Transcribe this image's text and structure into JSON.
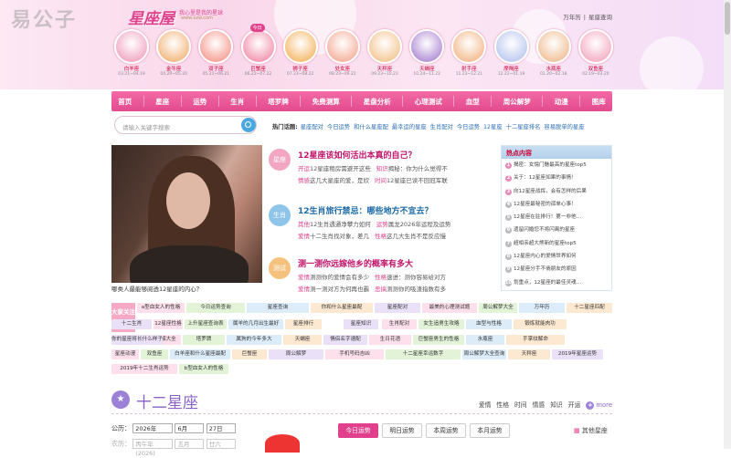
{
  "watermark": "易公子",
  "logo": {
    "title": "星座屋",
    "slogan": "我心里是我的星球",
    "url": "www.xzw.com"
  },
  "top_links": [
    "万年历",
    "|",
    "星座查询"
  ],
  "signs": [
    {
      "name": "白羊座",
      "date": "03.21~04.19",
      "color": "#f2b0c9"
    },
    {
      "name": "金牛座",
      "date": "04.20~05.20",
      "color": "#f4c08e"
    },
    {
      "name": "双子座",
      "date": "05.21~06.21",
      "color": "#f7a9a0"
    },
    {
      "name": "巨蟹座",
      "date": "06.22~07.22",
      "color": "#f3a0b8",
      "today": "今日"
    },
    {
      "name": "狮子座",
      "date": "07.23~08.22",
      "color": "#f6c17c"
    },
    {
      "name": "处女座",
      "date": "08.23~09.22",
      "color": "#f6b9a7"
    },
    {
      "name": "天秤座",
      "date": "09.23~10.23",
      "color": "#f5cda0"
    },
    {
      "name": "天蝎座",
      "date": "10.24~11.22",
      "color": "#b99ad9"
    },
    {
      "name": "射手座",
      "date": "11.23~12.21",
      "color": "#f4c39b"
    },
    {
      "name": "摩羯座",
      "date": "12.22~01.19",
      "color": "#c3cff0"
    },
    {
      "name": "水瓶座",
      "date": "01.20~02.18",
      "color": "#f2c7a3"
    },
    {
      "name": "双鱼座",
      "date": "02.19~03.20",
      "color": "#f6b7cb"
    }
  ],
  "nav": [
    "首页",
    "星座",
    "运势",
    "生肖",
    "塔罗牌",
    "免费测算",
    "星盘分析",
    "心理测试",
    "血型",
    "周公解梦",
    "动漫",
    "图库"
  ],
  "search": {
    "placeholder": "请输入关键字搜索"
  },
  "hot_words": {
    "label": "热门话题:",
    "items": [
      "星座配对",
      "今日运势",
      "和什么星座配",
      "最幸运的星座",
      "生肖配对",
      "今日运势",
      "12星座",
      "十二星座排名",
      "容易脱单的星座"
    ]
  },
  "feature": {
    "caption": "哪类人最能够阅透12星座的内心？"
  },
  "news": [
    {
      "badge": "星座",
      "badge_color": "#f3a6c2",
      "title": "12星座该如何活出本真的自己？",
      "title_color": "#c0156a",
      "rows": [
        [
          "开运",
          "12星座租房需避开这些",
          "知识",
          "揭秘：你为什么觉得不"
        ],
        [
          "情感",
          "这几大星座的爱，是欣",
          "时间",
          "12星座已读不回冠军联"
        ]
      ]
    },
    {
      "badge": "生肖",
      "badge_color": "#8ec4ea",
      "title": "12生肖旅行禁忌：哪些地方不宜去？",
      "title_color": "#1d6aa8",
      "rows": [
        [
          "其他",
          "12生肖遇通净攀力如何",
          "运势",
          "属龙2026年运程及运势"
        ],
        [
          "爱情",
          "十二生肖找对象，差几",
          "性格",
          "这几大生肖不是反应慢"
        ]
      ]
    },
    {
      "badge": "测试",
      "badge_color": "#f5c27d",
      "title": "测一测你远嫁他乡的概率有多大",
      "title_color": "#c0156a",
      "rows": [
        [
          "爱情",
          "测测你的爱情会有多少",
          "性格",
          "速进：测你容易给对方"
        ],
        [
          "爱情",
          "测一测对方为何再也霸",
          "恶搞",
          "测测你的吸渣指数有多"
        ]
      ]
    }
  ],
  "hot_content": {
    "title": "热点内容",
    "items": [
      "揭密：女懦门魅最高的星座top5",
      "关于：12星座如果的事情！",
      "向12星座战挥，会有怎样的后果",
      "12星座最秘密的孤单心事！",
      "12星座在驻排行！第一非他…",
      "遗留闪婚您不将闪离的星座",
      "超相亲超大熊新的星座top5",
      "12星座内心的爱情世界如何",
      "12星座分手不倘朋友的原因",
      "划重点，12星座的最佳灵魂…"
    ]
  },
  "tags": {
    "label": "大家关注",
    "items": [
      "a型血女人的性格",
      "今日运势查询",
      "星座查询",
      "你和什么星座最配",
      "星座配对",
      "最美的心理测试题",
      "周公解梦大全",
      "万年历",
      "十二星座匹配",
      "十二生肖",
      "12星座性格",
      "上升星座查询表",
      "属羊的几月出生最好",
      "星座排行",
      "星座知识",
      "生肖配对",
      "女生追男生攻略",
      "血型与性格",
      "锻炼就能肉功",
      "金牛座",
      "塔相图解大全",
      "塔罗牌",
      "属狗的今年多大",
      "天蝎座",
      "情侣名字速配",
      "生日花语",
      "巨蟹座男生的性格",
      "水瓶座",
      "手掌纹解命",
      "你的星座将长什么样子",
      "星座动漫",
      "双鱼座",
      "白羊座和什么星座最配",
      "巨蟹座",
      "周公解梦",
      "手机号码吉凶",
      "十二星座幸运数字",
      "周公解梦大全查询",
      "天秤座",
      "2019年星座运势",
      "2019年十二生肖运势",
      "b型血女人的性格"
    ]
  },
  "section": {
    "icon": "★",
    "title": "十二星座",
    "links": [
      "爱情",
      "性格",
      "时间",
      "情感",
      "知识",
      "开运"
    ],
    "more": "more"
  },
  "calendar": {
    "label": "公历：",
    "year": "2026年",
    "month": "6月",
    "day": "27日",
    "label2": "农历：",
    "lyear": "丙午年(2026)",
    "lmonth": "五月",
    "lday": "廿六"
  },
  "fortune_tabs": [
    "今日运势",
    "明日运势",
    "本周运势",
    "本月运势"
  ],
  "other_signs": "其他星座"
}
